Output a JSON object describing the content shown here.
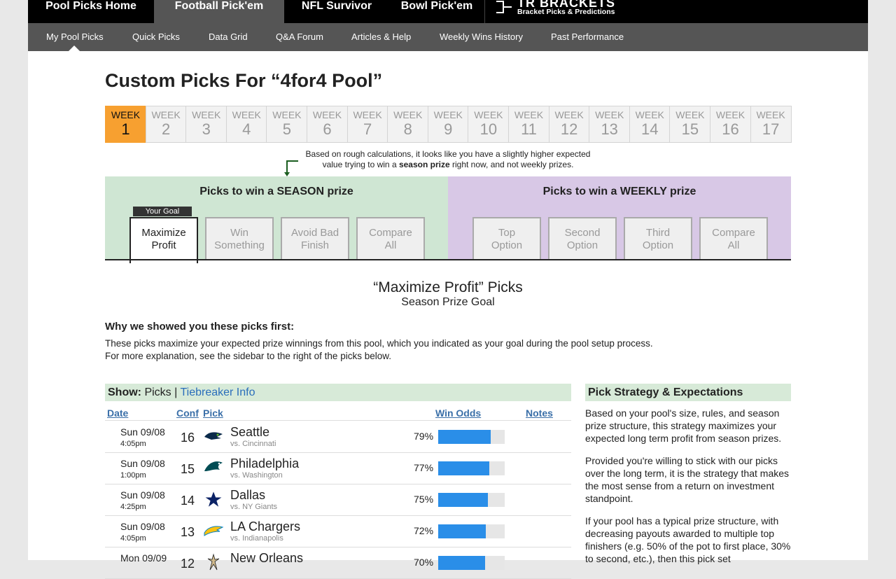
{
  "topnav": {
    "tabs": [
      {
        "label": "Pool Picks Home"
      },
      {
        "label": "Football Pick'em"
      },
      {
        "label": "NFL Survivor"
      },
      {
        "label": "Bowl Pick'em"
      }
    ],
    "brand_title": "TR BRACKETS",
    "brand_sub": "Bracket Picks & Predictions"
  },
  "subnav": {
    "items": [
      {
        "label": "My Pool Picks"
      },
      {
        "label": "Quick Picks"
      },
      {
        "label": "Data Grid"
      },
      {
        "label": "Q&A Forum"
      },
      {
        "label": "Articles & Help"
      },
      {
        "label": "Weekly Wins History"
      },
      {
        "label": "Past Performance"
      }
    ]
  },
  "page_title": "Custom Picks For “4for4 Pool”",
  "weeks": {
    "label": "WEEK",
    "numbers": [
      "1",
      "2",
      "3",
      "4",
      "5",
      "6",
      "7",
      "8",
      "9",
      "10",
      "11",
      "12",
      "13",
      "14",
      "15",
      "16",
      "17"
    ],
    "active": "1"
  },
  "hint": {
    "line1": "Based on rough calculations, it looks like you have a slightly higher expected",
    "line2a": "value trying to win a ",
    "line2b": "season prize",
    "line2c": " right now, and not weekly prizes."
  },
  "season": {
    "title": "Picks to win a SEASON prize",
    "badge": "Your Goal",
    "options": [
      {
        "l1": "Maximize",
        "l2": "Profit"
      },
      {
        "l1": "Win",
        "l2": "Something"
      },
      {
        "l1": "Avoid Bad",
        "l2": "Finish"
      },
      {
        "l1": "Compare",
        "l2": "All"
      }
    ]
  },
  "weekly": {
    "title": "Picks to win a WEEKLY prize",
    "options": [
      {
        "l1": "Top",
        "l2": "Option"
      },
      {
        "l1": "Second",
        "l2": "Option"
      },
      {
        "l1": "Third",
        "l2": "Option"
      },
      {
        "l1": "Compare",
        "l2": "All"
      }
    ]
  },
  "section": {
    "title": "“Maximize Profit” Picks",
    "subtitle": "Season Prize Goal",
    "why_title": "Why we showed you these picks first:",
    "why_line1": "These picks maximize your expected prize winnings from this pool, which you indicated as your goal during the pool setup process.",
    "why_line2": "For more explanation, see the sidebar to the right of the picks below."
  },
  "show": {
    "label": "Show:",
    "picks": "Picks",
    "sep": "|",
    "tiebreaker": "Tiebreaker Info"
  },
  "table": {
    "headers": {
      "date": "Date",
      "conf": "Conf",
      "pick": "Pick",
      "win_odds": "Win Odds",
      "notes": "Notes"
    },
    "rows": [
      {
        "date": "Sun 09/08",
        "time": "4:05pm",
        "conf": "16",
        "team": "Seattle",
        "vs": "vs. Cincinnati",
        "odds": "79%",
        "odds_value": 0.79,
        "logo": "seahawks-logo"
      },
      {
        "date": "Sun 09/08",
        "time": "1:00pm",
        "conf": "15",
        "team": "Philadelphia",
        "vs": "vs. Washington",
        "odds": "77%",
        "odds_value": 0.77,
        "logo": "eagles-logo"
      },
      {
        "date": "Sun 09/08",
        "time": "4:25pm",
        "conf": "14",
        "team": "Dallas",
        "vs": "vs. NY Giants",
        "odds": "75%",
        "odds_value": 0.75,
        "logo": "cowboys-logo"
      },
      {
        "date": "Sun 09/08",
        "time": "4:05pm",
        "conf": "13",
        "team": "LA Chargers",
        "vs": "vs. Indianapolis",
        "odds": "72%",
        "odds_value": 0.72,
        "logo": "chargers-logo"
      },
      {
        "date": "Mon 09/09",
        "time": "",
        "conf": "12",
        "team": "New Orleans",
        "vs": "",
        "odds": "70%",
        "odds_value": 0.7,
        "logo": "saints-logo"
      }
    ]
  },
  "sidebar": {
    "title": "Pick Strategy & Expectations",
    "p1": "Based on your pool's size, rules, and season prize structure, this strategy maximizes your expected long term profit from season prizes.",
    "p2": "Provided you're willing to stick with our picks over the long term, it is the strategy that makes the most sense from a return on investment standpoint.",
    "p3": "If your pool has a typical prize structure, with decreasing payouts awarded to multiple top finishers (e.g. 50% of the pot to first place, 30% to second, etc.), then this pick set"
  },
  "colors": {
    "active_week": "#f7a030",
    "season_bg": "#cfe6d3",
    "weekly_bg": "#d8c8e6",
    "odds_bar": "#2a8ee8",
    "link": "#2a6ebb"
  }
}
